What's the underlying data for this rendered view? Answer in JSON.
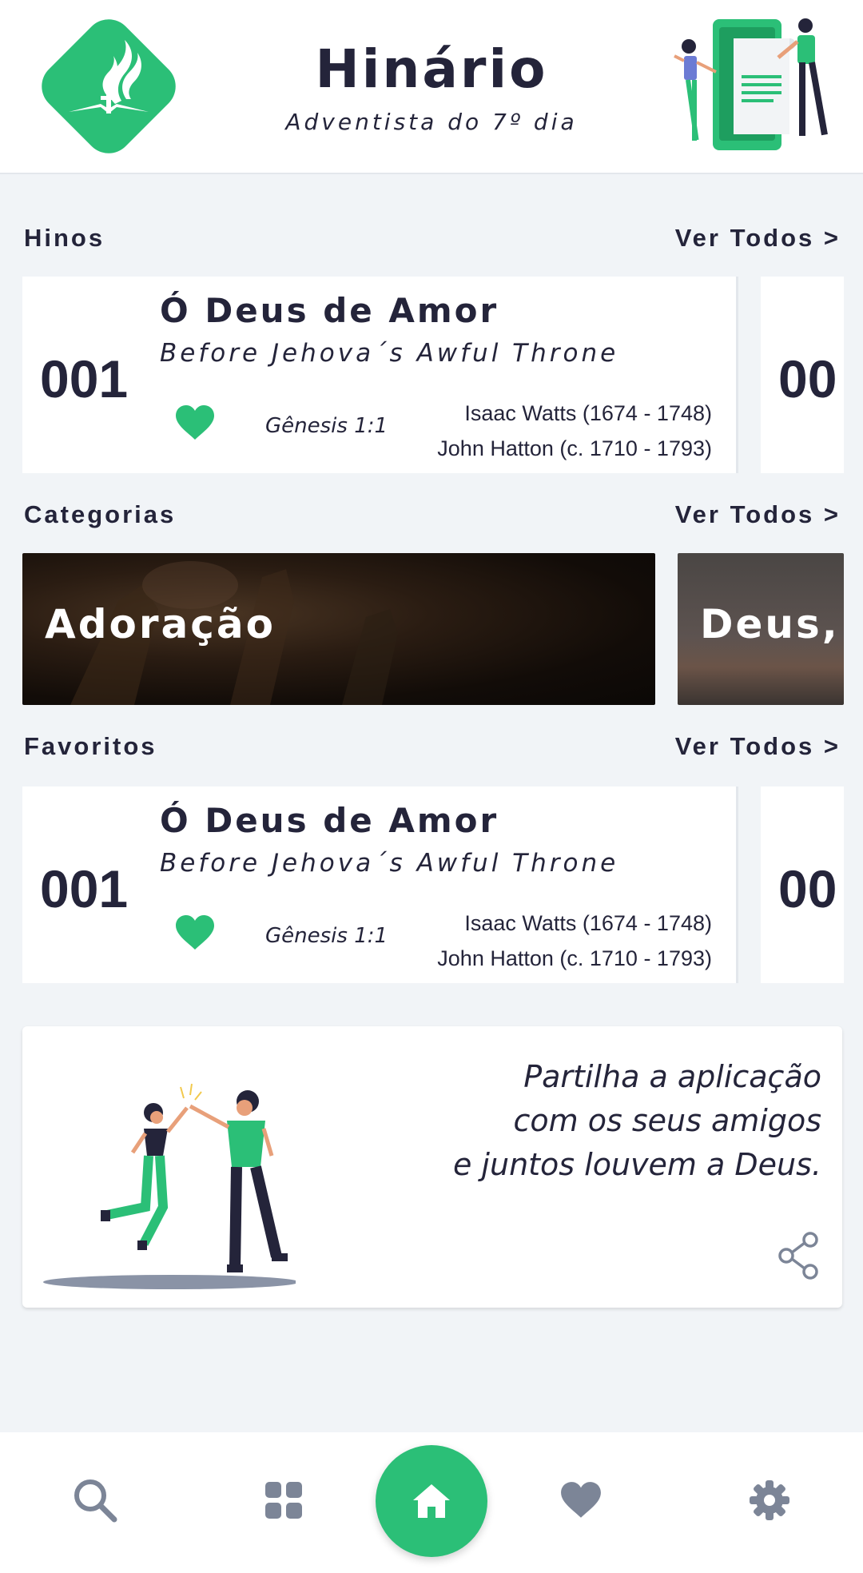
{
  "app": {
    "title": "Hinário",
    "subtitle": "Adventista do 7º dia"
  },
  "sections": {
    "hinos": {
      "title": "Hinos",
      "link": "Ver Todos >"
    },
    "categorias": {
      "title": "Categorias",
      "link": "Ver Todos >"
    },
    "favoritos": {
      "title": "Favoritos",
      "link": "Ver Todos >"
    }
  },
  "hymns": [
    {
      "number": "001",
      "title": "Ó Deus de Amor",
      "original": "Before Jehova´s Awful Throne",
      "verse": "Gênesis 1:1",
      "author1": "Isaac Watts (1674 - 1748)",
      "author2": "John Hatton (c. 1710 - 1793)",
      "favorite": true
    }
  ],
  "hymn_peek": {
    "number": "00"
  },
  "favorites": [
    {
      "number": "001",
      "title": "Ó Deus de Amor",
      "original": "Before Jehova´s Awful Throne",
      "verse": "Gênesis 1:1",
      "author1": "Isaac Watts (1674 - 1748)",
      "author2": "John Hatton (c. 1710 - 1793)",
      "favorite": true
    }
  ],
  "favorite_peek": {
    "number": "00"
  },
  "categories": [
    {
      "label": "Adoração"
    },
    {
      "label": "Deus, o"
    }
  ],
  "share": {
    "line1": "Partilha a aplicação",
    "line2": "com os seus amigos",
    "line3": "e juntos louvem a Deus."
  },
  "nav": {
    "items": [
      "search-icon",
      "grid-icon",
      "home-icon",
      "heart-icon",
      "gear-icon"
    ],
    "active": "home-icon"
  },
  "colors": {
    "accent": "#2bbf77",
    "text": "#24243a",
    "icon_muted": "#7c8597",
    "background": "#f1f4f7"
  }
}
